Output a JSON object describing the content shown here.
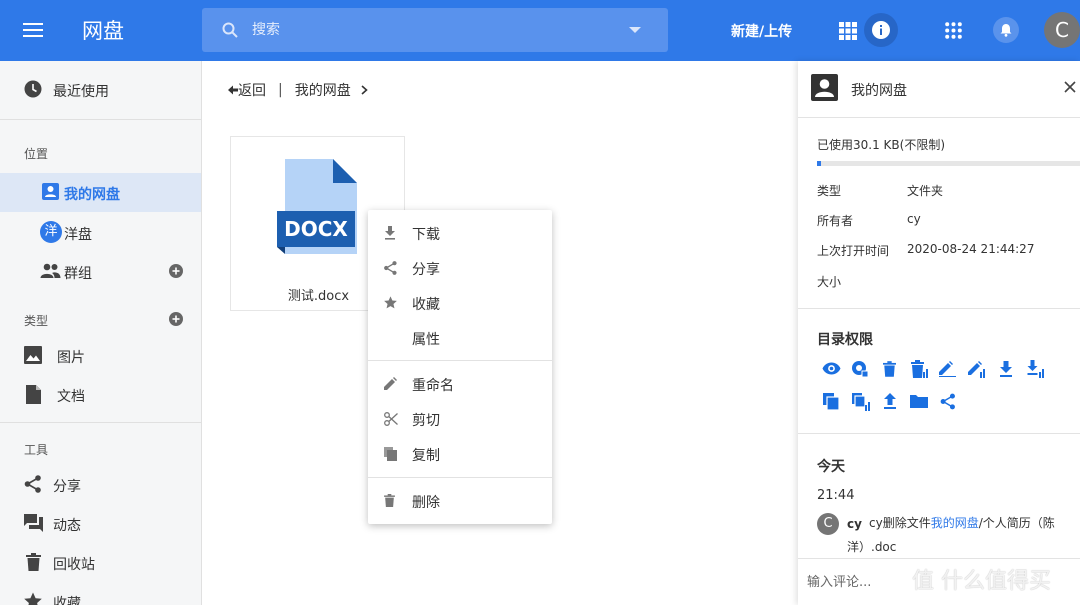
{
  "header": {
    "title": "网盘",
    "search_placeholder": "搜索",
    "new_upload_label": "新建/上传",
    "avatar_letter": "C"
  },
  "sidebar": {
    "recent": "最近使用",
    "section_location": "位置",
    "my_drive": "我的网盘",
    "yang_drive": "洋盘",
    "yang_avatar": "洋",
    "groups": "群组",
    "section_type": "类型",
    "pictures": "图片",
    "documents": "文档",
    "section_tools": "工具",
    "share": "分享",
    "activity": "动态",
    "recycle": "回收站",
    "favorites": "收藏"
  },
  "breadcrumb": {
    "back": "返回",
    "separator": "|",
    "current": "我的网盘"
  },
  "file": {
    "badge": "DOCX",
    "name": "测试.docx"
  },
  "context_menu": {
    "download": "下载",
    "share": "分享",
    "favorite": "收藏",
    "properties": "属性",
    "rename": "重命名",
    "cut": "剪切",
    "copy": "复制",
    "delete": "删除"
  },
  "panel": {
    "title": "我的网盘",
    "usage_text": "已使用30.1 KB(不限制)",
    "usage_fraction": 0.015,
    "props": [
      {
        "key": "类型",
        "value": "文件夹"
      },
      {
        "key": "所有者",
        "value": "cy"
      },
      {
        "key": "上次打开时间",
        "value": "2020-08-24 21:44:27"
      },
      {
        "key": "大小",
        "value": ""
      }
    ],
    "permissions_title": "目录权限",
    "today_title": "今天",
    "activity_time": "21:44",
    "activity_avatar": "C",
    "activity_user": "cy",
    "activity_prefix": "cy删除文件",
    "activity_link": "我的网盘",
    "activity_suffix": "/个人简历（陈洋）.doc",
    "comment_placeholder": "输入评论..."
  },
  "colors": {
    "brand": "#2f79e8",
    "sidebar_bg": "#f5f6f7",
    "docx_blue": "#1d5fb0"
  },
  "watermark": "值 什么值得买"
}
